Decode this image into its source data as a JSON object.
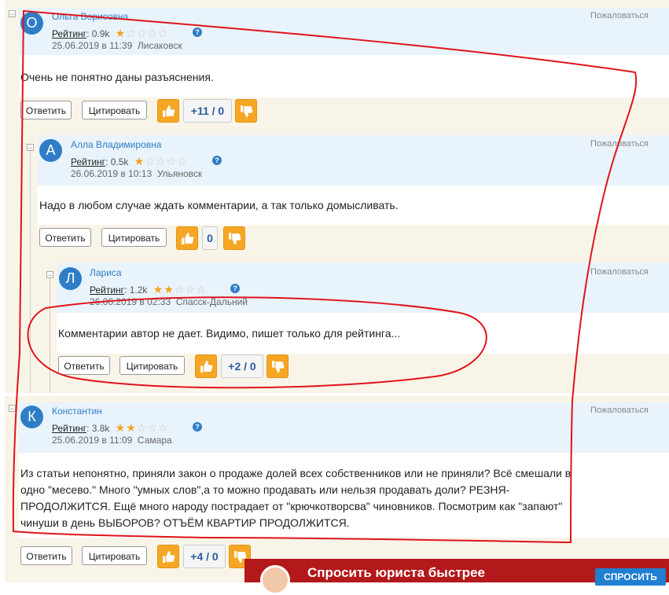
{
  "labels": {
    "reply": "Ответить",
    "quote": "Цитировать",
    "report": "Пожаловаться",
    "rating_label": "Рейтинг",
    "help": "?",
    "collapse": "−"
  },
  "comments": [
    {
      "initial": "О",
      "author": "Ольга Ворисовна",
      "rating_value": ": 0.9k",
      "stars_on": 1,
      "date": "25.06.2019 в 11:39",
      "city": "Лисаковск",
      "text": "Очень не понятно даны разъяснения.",
      "votes": "+11 / 0"
    },
    {
      "initial": "А",
      "author": "Алла Владимировна",
      "rating_value": ": 0.5k",
      "stars_on": 1,
      "date": "26.06.2019 в 10:13",
      "city": "Ульяновск",
      "text": "Надо в любом случае ждать комментарии, а так только домысливать.",
      "votes": "0"
    },
    {
      "initial": "Л",
      "author": "Лариса",
      "rating_value": ": 1.2k",
      "stars_on": 2,
      "date": "26.06.2019 в 02:33",
      "city": "Спасск-Дальний",
      "text": "Комментарии автор не дает. Видимо, пишет только для рейтинга...",
      "votes": "+2 / 0"
    },
    {
      "initial": "К",
      "author": "Константин",
      "rating_value": ": 3.8k",
      "stars_on": 2,
      "date": "25.06.2019 в 11:09",
      "city": "Самара",
      "text_lines": [
        "Из статьи непонятно, приняли закон о продаже долей всех собственников или не приняли? Всё смешали в",
        "одно \"месево.\" Много \"умных слов\",а то можно продавать или нельзя продавать доли? РЕЗНЯ-",
        "ПРОДОЛЖИТСЯ. Ещё много народу пострадает от \"крючкотворсва\" чиновников. Посмотрим как \"запают\"",
        "чинуши в день ВЫБОРОВ? ОТЪЁМ КВАРТИР ПРОДОЛЖИТСЯ."
      ],
      "votes": "+4 / 0"
    }
  ],
  "banner": {
    "title": "Спросить юриста быстрее",
    "button": "СПРОСИТЬ"
  },
  "colors": {
    "accent": "#2f7dc6",
    "annotation": "#e0141b",
    "thumb": "#f5a623",
    "banner": "#b3181b"
  }
}
